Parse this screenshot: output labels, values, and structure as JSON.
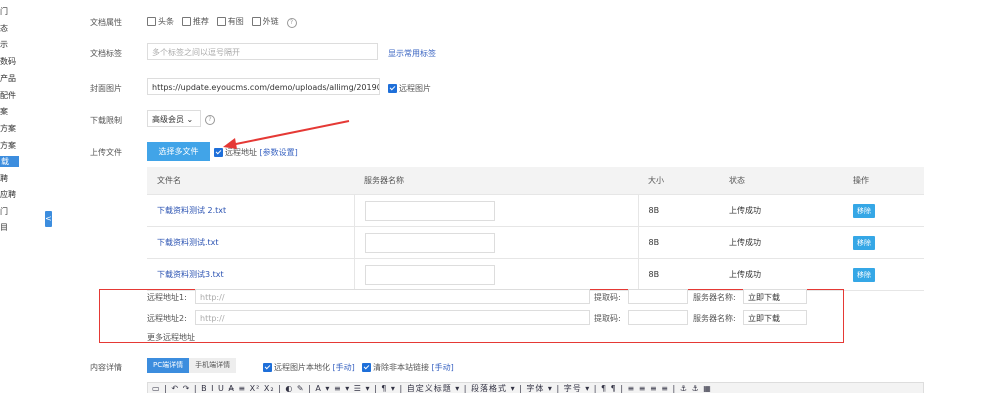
{
  "sidebar": {
    "items": [
      "门",
      "态",
      "示",
      "数码",
      "产品",
      "配件",
      "案",
      "方案",
      "方案",
      "载",
      "聘",
      "应聘",
      "门",
      "目"
    ],
    "active_index": 9,
    "collapse_glyph": "<"
  },
  "form": {
    "attr_label": "文档属性",
    "attr_options": [
      {
        "label": "头条",
        "checked": false
      },
      {
        "label": "推荐",
        "checked": false
      },
      {
        "label": "有图",
        "checked": false
      },
      {
        "label": "外链",
        "checked": false
      }
    ],
    "tags_label": "文档标签",
    "tags_placeholder": "多个标签之间以逗号隔开",
    "tags_link": "显示常用标签",
    "cover_label": "封面图片",
    "cover_value": "https://update.eyoucms.com/demo/uploads/allimg/2019080",
    "cover_remote_label": "远程图片",
    "download_label": "下载限制",
    "download_value": "高级会员",
    "upload_label": "上传文件",
    "upload_button": "选择多文件",
    "remote_addr_label": "远程地址",
    "param_link": "[参数设置]"
  },
  "files_table": {
    "headers": [
      "文件名",
      "服务器名称",
      "大小",
      "状态",
      "操作"
    ],
    "rows": [
      {
        "name": "下载资料测试 2.txt",
        "size": "8B",
        "status": "上传成功",
        "action": "移除"
      },
      {
        "name": "下载资料测试.txt",
        "size": "8B",
        "status": "上传成功",
        "action": "移除"
      },
      {
        "name": "下载资料测试3.txt",
        "size": "8B",
        "status": "上传成功",
        "action": "移除"
      }
    ]
  },
  "remote": {
    "rows": [
      {
        "label": "远程地址1:",
        "placeholder": "http://",
        "code_label": "提取码:",
        "server_label": "服务器名称:",
        "server_value": "立即下载"
      },
      {
        "label": "远程地址2:",
        "placeholder": "http://",
        "code_label": "提取码:",
        "server_label": "服务器名称:",
        "server_value": "立即下载"
      }
    ],
    "more_link": "更多远程地址"
  },
  "content": {
    "label": "内容详情",
    "tab_pc": "PC端详情",
    "tab_mobile": "手机端详情",
    "localize_label": "远程图片本地化",
    "localize_link": "[手动]",
    "clear_links_label": "清除非本站链接",
    "clear_links_link": "[手动]",
    "toolbar_text": "▭ | ↶ ↷ | B I U A̶ ≡ X² X₂ | ◐ ✎ | A ▾ ≡ ▾ ☰ ▾ | ¶ ▾ | 自定义标题 ▾ | 段落格式 ▾ | 字体 ▾ | 字号 ▾ | ¶ ¶ | ≡ ≡ ≡ ≡ | ⚓ ⚓ ▦"
  },
  "colors": {
    "accent": "#3c8dde",
    "link": "#2a52b2",
    "success": "#4cae4c",
    "highlight_box": "#e53935",
    "arrow": "#e53935"
  }
}
